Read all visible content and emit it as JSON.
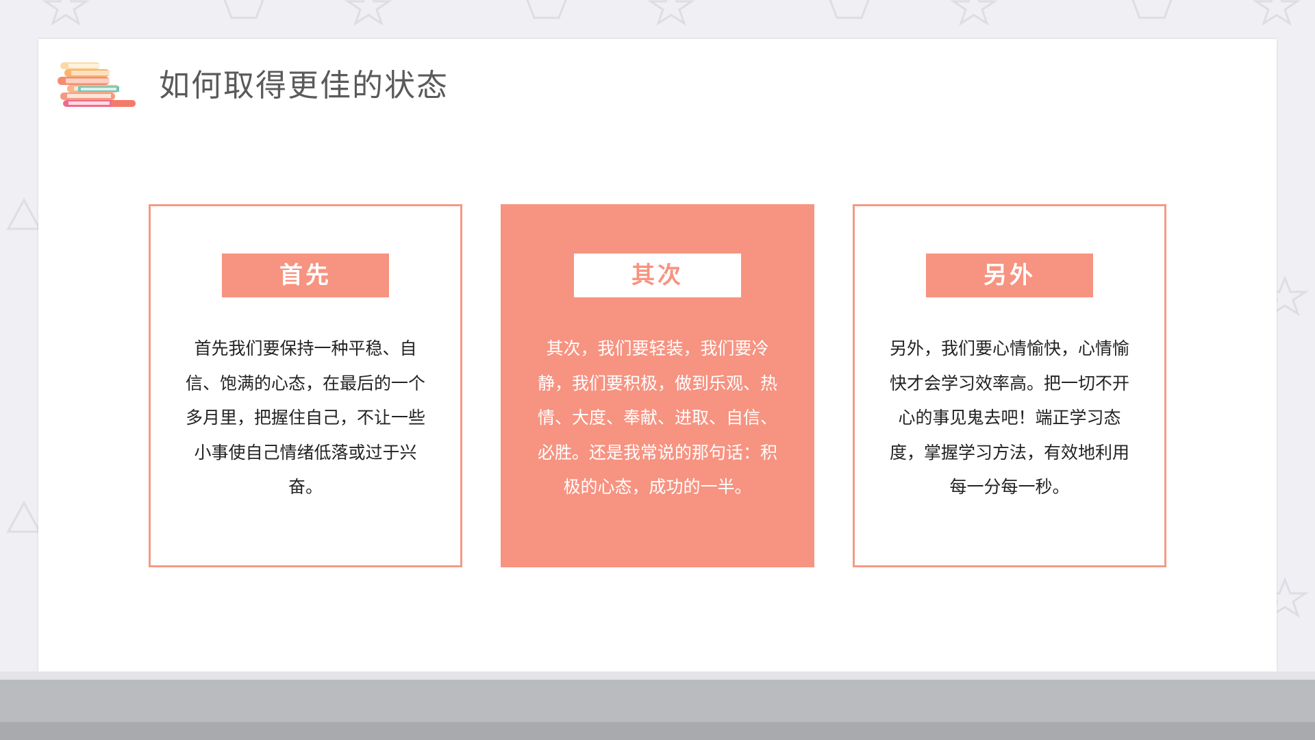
{
  "slide": {
    "title": "如何取得更佳的状态"
  },
  "colors": {
    "accent": "#f79381",
    "accent_border": "#f49a86",
    "background": "#f0eff3",
    "card": "#ffffff",
    "title_text": "#5a5a5a",
    "body_text": "#222222",
    "base_band": "#babbbf"
  },
  "icons": {
    "title_icon": "books-stack-icon"
  },
  "boxes": [
    {
      "style": "outline",
      "label": "首先",
      "text": "首先我们要保持一种平稳、自信、饱满的心态，在最后的一个多月里，把握住自己，不让一些小事使自己情绪低落或过于兴奋。"
    },
    {
      "style": "filled",
      "label": "其次",
      "text": "其次，我们要轻装，我们要冷静，我们要积极，做到乐观、热情、大度、奉献、进取、自信、必胜。还是我常说的那句话：积极的心态，成功的一半。"
    },
    {
      "style": "outline",
      "label": "另外",
      "text": "另外，我们要心情愉快，心情愉快才会学习效率高。把一切不开心的事见鬼去吧！端正学习态度，掌握学习方法，有效地利用每一分每一秒。"
    }
  ]
}
